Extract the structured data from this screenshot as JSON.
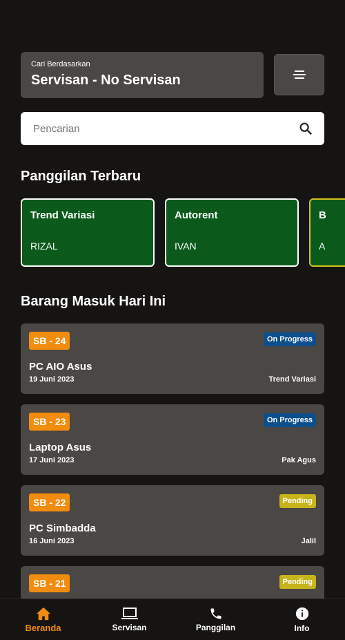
{
  "search_by": {
    "label": "Cari Berdasarkan",
    "value": "Servisan - No Servisan"
  },
  "search": {
    "placeholder": "Pencarian"
  },
  "recent_calls": {
    "title": "Panggilan Terbaru",
    "items": [
      {
        "name": "Trend Variasi",
        "person": "RIZAL"
      },
      {
        "name": "Autorent",
        "person": "IVAN"
      },
      {
        "name": "B",
        "person": "A"
      }
    ]
  },
  "incoming": {
    "title": "Barang Masuk Hari Ini",
    "items": [
      {
        "code": "SB - 24",
        "status": "On Progress",
        "name": "PC AIO Asus",
        "date": "19 Juni 2023",
        "owner": "Trend Variasi"
      },
      {
        "code": "SB - 23",
        "status": "On Progress",
        "name": "Laptop Asus",
        "date": "17 Juni 2023",
        "owner": "Pak Agus"
      },
      {
        "code": "SB - 22",
        "status": "Pending",
        "name": "PC Simbadda",
        "date": "16 Juni 2023",
        "owner": "Jalil"
      },
      {
        "code": "SB - 21",
        "status": "Pending",
        "name": "",
        "date": "",
        "owner": ""
      }
    ]
  },
  "nav": {
    "home": "Beranda",
    "service": "Servisan",
    "calls": "Panggilan",
    "info": "Info"
  },
  "colors": {
    "accent": "#f28c0f",
    "card_green": "#0b5a1c",
    "progress": "#0c4f8c",
    "pending": "#c7b41a"
  }
}
